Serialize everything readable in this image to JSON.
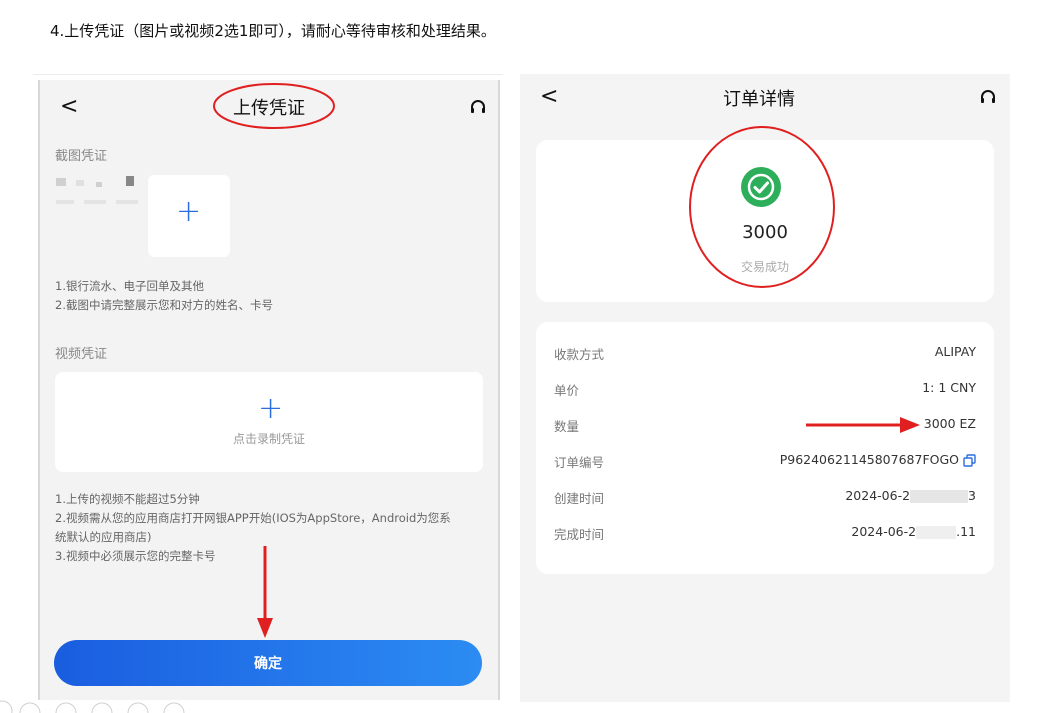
{
  "instruction": "4.上传凭证（图片或视频2选1即可），请耐心等待审核和处理结果。",
  "left_screen": {
    "back_glyph": "<",
    "title": "上传凭证",
    "screenshot_section": "截图凭证",
    "screenshot_hints": [
      "1.银行流水、电子回单及其他",
      "2.截图中请完整展示您和对方的姓名、卡号"
    ],
    "video_section": "视频凭证",
    "video_button": "点击录制凭证",
    "video_hints": [
      "1.上传的视频不能超过5分钟",
      "2.视频需从您的应用商店打开网银APP开始(IOS为AppStore，Android为您系",
      "统默认的应用商店)",
      "3.视频中必须展示您的完整卡号"
    ],
    "confirm_button": "确定",
    "accent_color": "#2a6de0"
  },
  "right_screen": {
    "back_glyph": "<",
    "title": "订单详情",
    "amount": "3000",
    "status": "交易成功",
    "status_color": "#2dae5a",
    "details": [
      {
        "label": "收款方式",
        "value": "ALIPAY"
      },
      {
        "label": "单价",
        "value": "1: 1 CNY"
      },
      {
        "label": "数量",
        "value": "3000 EZ"
      },
      {
        "label": "订单编号",
        "value": "P96240621145807687FOGO"
      },
      {
        "label": "创建时间",
        "value_prefix": "2024-06-2",
        "value_suffix": "3"
      },
      {
        "label": "完成时间",
        "value_prefix": "2024-06-2",
        "value_suffix": ".11"
      }
    ]
  },
  "annotation_color": "#e02020",
  "icons": {
    "back": "chevron-left-icon",
    "support": "headset-icon",
    "add": "plus-icon",
    "success": "check-circle-icon",
    "copy": "copy-icon"
  }
}
